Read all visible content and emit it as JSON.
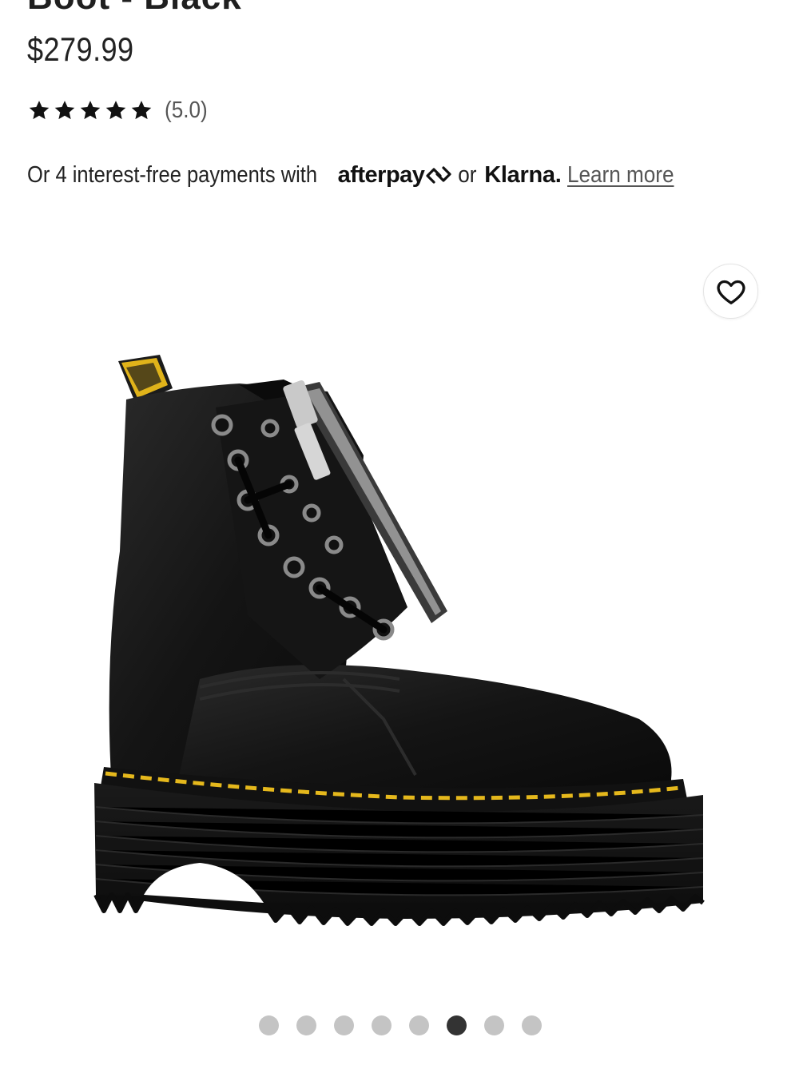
{
  "product": {
    "title": "Boot - Black",
    "price": "$279.99",
    "rating": {
      "stars": 5,
      "value_label": "(5.0)"
    }
  },
  "payments": {
    "lead_text": "Or 4 interest-free payments with",
    "afterpay_label": "afterpay",
    "or_text": "or",
    "klarna_label": "Klarna.",
    "learn_more": "Learn more"
  },
  "wishlist": {
    "icon": "heart-icon"
  },
  "gallery": {
    "image_count": 8,
    "active_index": 5
  },
  "colors": {
    "text": "#1f1f1f",
    "muted": "#555555",
    "dot": "#c4c4c4",
    "dot_active": "#333333",
    "stitch": "#e5b81c"
  }
}
